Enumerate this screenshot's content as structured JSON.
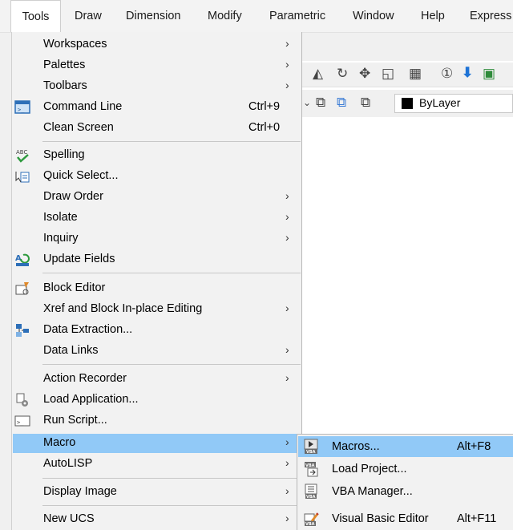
{
  "menubar": {
    "items": [
      "Tools",
      "Draw",
      "Dimension",
      "Modify",
      "Parametric",
      "Window",
      "Help",
      "Express"
    ],
    "active": "Tools"
  },
  "background": {
    "layer_label": "ByLayer",
    "colors": {
      "accent_blue": "#1e73d6",
      "green": "#2e8b3a"
    }
  },
  "menu": {
    "items": [
      {
        "label": "Workspaces",
        "arrow": "›"
      },
      {
        "label": "Palettes",
        "arrow": "›"
      },
      {
        "label": "Toolbars",
        "arrow": "›"
      },
      {
        "label": "Command Line",
        "shortcut": "Ctrl+9",
        "icon": "command-line-icon"
      },
      {
        "label": "Clean Screen",
        "shortcut": "Ctrl+0"
      },
      {
        "label": "Spelling",
        "icon": "spelling-icon"
      },
      {
        "label": "Quick Select...",
        "icon": "quick-select-icon"
      },
      {
        "label": "Draw Order",
        "arrow": "›"
      },
      {
        "label": "Isolate",
        "arrow": "›"
      },
      {
        "label": "Inquiry",
        "arrow": "›"
      },
      {
        "label": "Update Fields",
        "icon": "update-fields-icon"
      },
      {
        "label": "Block Editor",
        "icon": "block-editor-icon"
      },
      {
        "label": "Xref and Block In-place Editing",
        "arrow": "›"
      },
      {
        "label": "Data Extraction...",
        "icon": "data-extraction-icon"
      },
      {
        "label": "Data Links",
        "arrow": "›"
      },
      {
        "label": "Action Recorder",
        "arrow": "›"
      },
      {
        "label": "Load Application...",
        "icon": "load-application-icon"
      },
      {
        "label": "Run Script...",
        "icon": "run-script-icon"
      },
      {
        "label": "Macro",
        "arrow": "›",
        "highlighted": true
      },
      {
        "label": "AutoLISP",
        "arrow": "›"
      },
      {
        "label": "Display Image",
        "arrow": "›"
      },
      {
        "label": "New UCS",
        "arrow": "›"
      }
    ]
  },
  "submenu": {
    "items": [
      {
        "label": "Macros...",
        "shortcut": "Alt+F8",
        "icon": "macros-icon",
        "highlighted": true
      },
      {
        "label": "Load Project...",
        "icon": "load-project-icon"
      },
      {
        "label": "VBA Manager...",
        "icon": "vba-manager-icon"
      },
      {
        "label": "Visual Basic Editor",
        "shortcut": "Alt+F11",
        "icon": "visual-basic-editor-icon"
      }
    ]
  },
  "colors": {
    "highlight": "#91c9f7",
    "menu_bg": "#f2f2f2"
  }
}
